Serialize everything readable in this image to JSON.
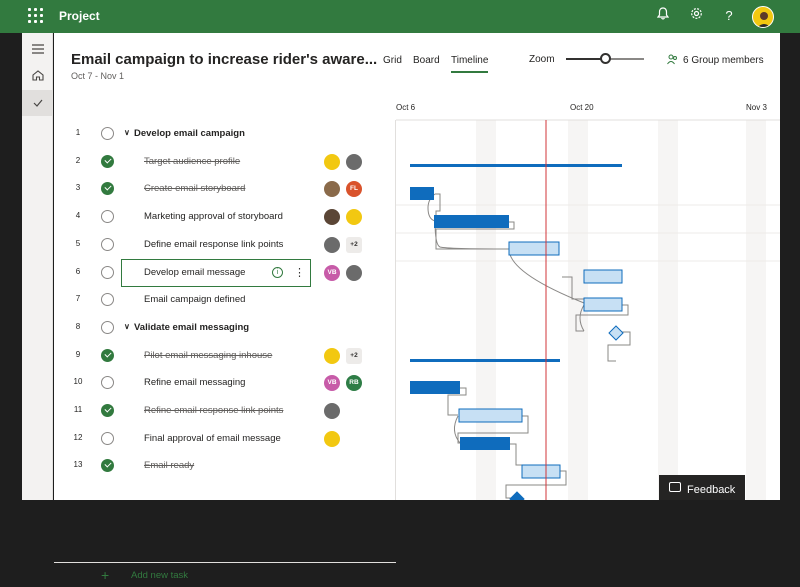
{
  "app": {
    "name": "Project",
    "top_icons": [
      "bell-icon",
      "gear-icon",
      "help-icon"
    ]
  },
  "plan": {
    "title": "Email campaign to increase rider's aware...",
    "dates": "Oct 7 - Nov 1"
  },
  "views": [
    {
      "label": "Grid",
      "active": false
    },
    {
      "label": "Board",
      "active": false
    },
    {
      "label": "Timeline",
      "active": true
    }
  ],
  "zoom": {
    "label": "Zoom",
    "level": 0.5
  },
  "members": {
    "label": "6 Group members"
  },
  "timeline": {
    "dates": [
      "Oct 6",
      "Oct 20",
      "Nov 3"
    ]
  },
  "tasks": [
    {
      "num": "1",
      "name": "Develop email campaign",
      "group": true,
      "done": false,
      "avatars": []
    },
    {
      "num": "2",
      "name": "Target audience profile",
      "group": false,
      "done": true,
      "avatars": [
        {
          "text": "",
          "color": "#f2c811"
        },
        {
          "text": "",
          "color": "#6b6b6b"
        }
      ]
    },
    {
      "num": "3",
      "name": "Create email storyboard",
      "group": false,
      "done": true,
      "avatars": [
        {
          "text": "",
          "color": "#8a6a4a"
        },
        {
          "text": "FL",
          "color": "#d9532c"
        }
      ]
    },
    {
      "num": "4",
      "name": "Marketing approval of storyboard",
      "group": false,
      "done": false,
      "avatars": [
        {
          "text": "",
          "color": "#5b4636"
        },
        {
          "text": "",
          "color": "#f2c811"
        }
      ]
    },
    {
      "num": "5",
      "name": "Define email response link points",
      "group": false,
      "done": false,
      "avatars": [
        {
          "text": "",
          "color": "#6b6b6b"
        },
        {
          "text": "+2",
          "color": "more"
        }
      ]
    },
    {
      "num": "6",
      "name": "Develop email message",
      "group": false,
      "done": false,
      "selected": true,
      "avatars": [
        {
          "text": "VB",
          "color": "#c75ba8"
        },
        {
          "text": "",
          "color": "#6b6b6b"
        }
      ]
    },
    {
      "num": "7",
      "name": "Email campaign defined",
      "group": false,
      "done": false,
      "avatars": []
    },
    {
      "num": "8",
      "name": "Validate email messaging",
      "group": true,
      "done": false,
      "avatars": []
    },
    {
      "num": "9",
      "name": "Pilot email messaging inhouse",
      "group": false,
      "done": true,
      "avatars": [
        {
          "text": "",
          "color": "#f2c811"
        },
        {
          "text": "+2",
          "color": "more"
        }
      ]
    },
    {
      "num": "10",
      "name": "Refine email messaging",
      "group": false,
      "done": false,
      "avatars": [
        {
          "text": "VB",
          "color": "#c75ba8"
        },
        {
          "text": "RB",
          "color": "#2e7d46"
        }
      ]
    },
    {
      "num": "11",
      "name": "Refine email response link points",
      "group": false,
      "done": true,
      "avatars": [
        {
          "text": "",
          "color": "#6b6b6b"
        }
      ]
    },
    {
      "num": "12",
      "name": "Final approval of email message",
      "group": false,
      "done": false,
      "avatars": [
        {
          "text": "",
          "color": "#f2c811"
        }
      ]
    },
    {
      "num": "13",
      "name": "Email ready",
      "group": false,
      "done": true,
      "avatars": []
    }
  ],
  "add_task": {
    "label": "Add new task"
  },
  "feedback": {
    "label": "Feedback"
  },
  "colors": {
    "brand": "#327a3f",
    "bar": "#0f6cbd",
    "bar_light": "#c7e0f4",
    "today": "#d13438"
  }
}
